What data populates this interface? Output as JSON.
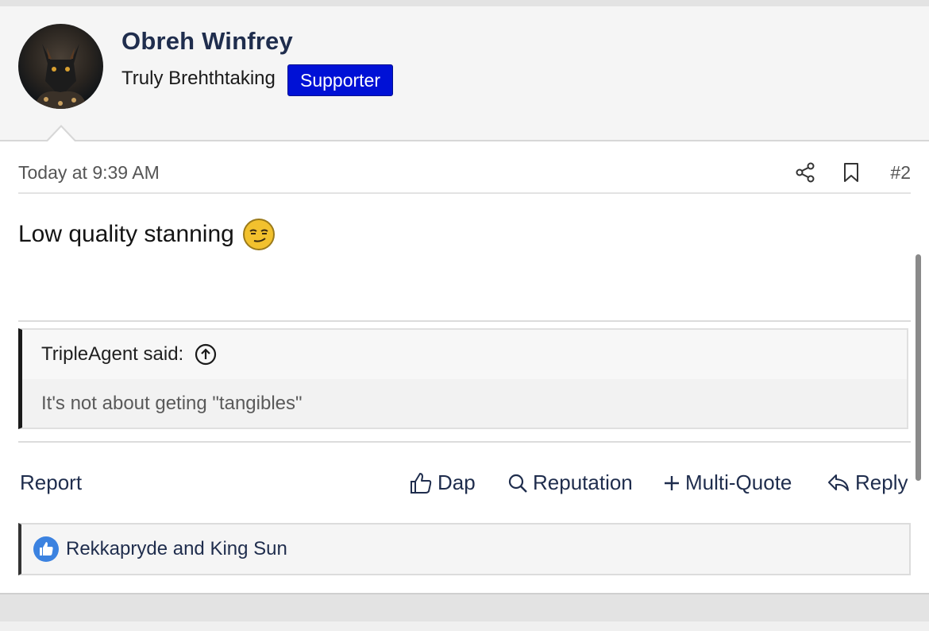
{
  "user": {
    "name": "Obreh Winfrey",
    "title": "Truly Brehthtaking",
    "badge": "Supporter",
    "badge_color": "#0011d6"
  },
  "post": {
    "timestamp": "Today at 9:39 AM",
    "number": "#2",
    "text": "Low quality stanning",
    "emoji_icon": "smirk-emoji-icon",
    "share_icon": "share-icon",
    "bookmark_icon": "bookmark-icon"
  },
  "quote": {
    "author": "TripleAgent said:",
    "body": "It's not about geting \"tangibles\""
  },
  "actions": {
    "report": "Report",
    "dap": "Dap",
    "reputation": "Reputation",
    "multiquote": "Multi-Quote",
    "reply": "Reply"
  },
  "reactions": {
    "text": "Rekkapryde and King Sun",
    "icon": "like-icon",
    "icon_color": "#3b82e0"
  }
}
